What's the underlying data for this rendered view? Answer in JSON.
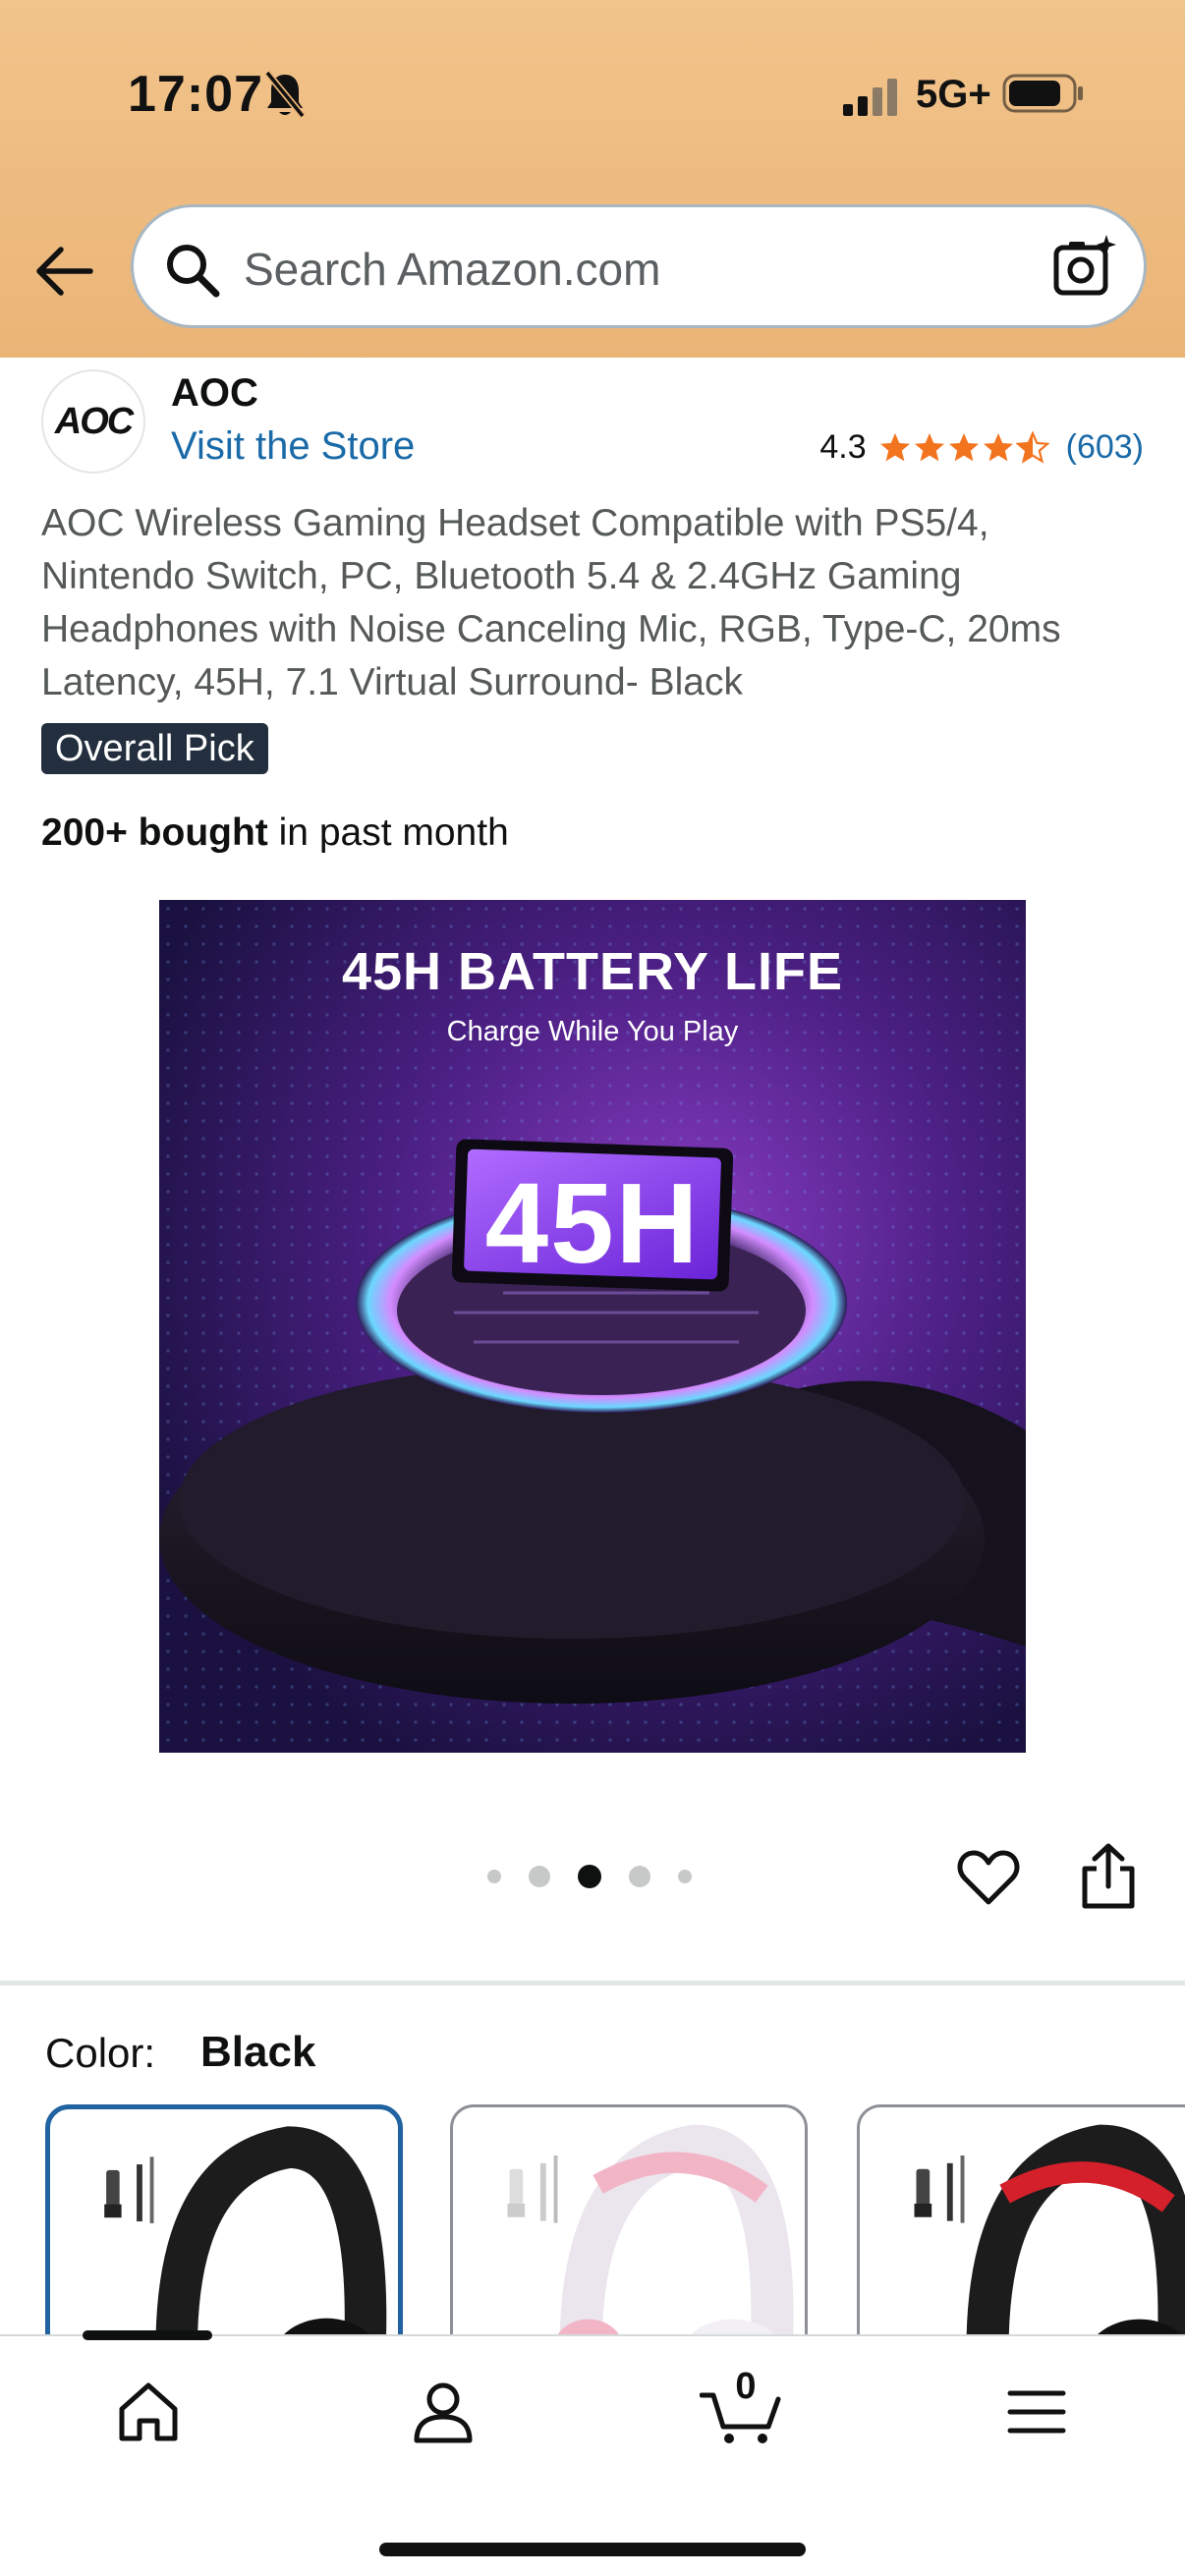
{
  "status_bar": {
    "time": "17:07",
    "network": "5G+"
  },
  "search": {
    "placeholder": "Search Amazon.com"
  },
  "brand": {
    "logo_text": "AOC",
    "name": "AOC",
    "store_link": "Visit the Store"
  },
  "rating": {
    "value": "4.3",
    "stars": 4.3,
    "count": "(603)"
  },
  "product": {
    "title": "AOC Wireless Gaming Headset Compatible with PS5/4, Nintendo Switch, PC, Bluetooth 5.4 & 2.4GHz Gaming Headphones with Noise Canceling Mic, RGB, Type-C, 20ms Latency, 45H, 7.1 Virtual Surround- Black",
    "badge": "Overall Pick",
    "bought_bold": "200+ bought",
    "bought_rest": " in past month"
  },
  "image": {
    "heading": "45H BATTERY LIFE",
    "subheading": "Charge While You Play",
    "display_text": "45H",
    "carousel_total": 5,
    "carousel_active": 3
  },
  "color": {
    "label": "Color:",
    "value": "Black",
    "options": [
      {
        "name": "Black",
        "selected": true
      },
      {
        "name": "White Pink",
        "selected": false
      },
      {
        "name": "Black Red",
        "selected": false
      }
    ]
  },
  "bottom_nav": {
    "items": [
      "home-icon",
      "account-icon",
      "cart-icon",
      "menu-icon"
    ],
    "cart_count": "0"
  },
  "colors": {
    "header_bg": "#ebb477",
    "link": "#1a6aa8",
    "star": "#f3741f",
    "selected_border": "#2162a1"
  }
}
